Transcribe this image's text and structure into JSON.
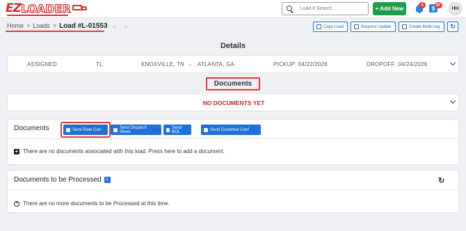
{
  "header": {
    "logo_text_ez": "EZ",
    "logo_text_rest": "LOADER",
    "search_placeholder": "Load # Search...",
    "add_new_label": "+ Add New",
    "notifications_count": "3",
    "messages_count": "97",
    "messages_icon_glyph": "$",
    "user_initials": "HH",
    "accent_color": "#1e9e4a",
    "brand_color": "#d32f2f"
  },
  "breadcrumb": {
    "home": "Home",
    "loads": "Loads",
    "current": "Load #L-01553",
    "separator": ">"
  },
  "toolbar": {
    "copy_load": "Copy Load",
    "request_update": "Request Update",
    "create_multi_leg": "Create Multi-Leg"
  },
  "details": {
    "title": "Details",
    "status": "ASSIGNED",
    "type": "TL",
    "origin": "KNOXVILLE, TN",
    "route_arrow": "→",
    "destination": "ATLANTA, GA",
    "pickup": "PICKUP: 04/22/2026",
    "dropoff": "DROPOFF: 04/24/2026"
  },
  "documents_section": {
    "title": "Documents",
    "empty_banner": "NO DOCUMENTS YET"
  },
  "documents_card": {
    "label": "Documents",
    "send_rate_con": "Send Rate Con",
    "send_dispatch_sheet": "Send Dispatch Sheet",
    "send_bol": "Send BOL",
    "send_customer_conf": "Send Customer Conf",
    "empty_message": "There are no documents associated with this load. Press here to add a document."
  },
  "to_be_processed": {
    "label": "Documents to be Processed",
    "info_glyph": "i",
    "empty_message": "There are no more documents to be Processed at this time."
  }
}
